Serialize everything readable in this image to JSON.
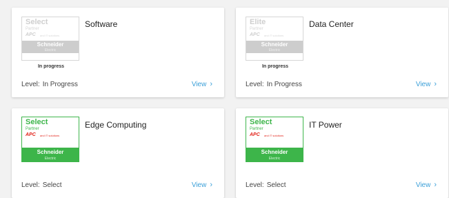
{
  "cards": [
    {
      "title": "Software",
      "badge": {
        "tier": "Select",
        "sub": "Partner",
        "brand": "APC",
        "brand_note": "and IT solutions",
        "bar": "Schneider",
        "bar_sub": "Electric",
        "status": "In progress"
      },
      "level_label": "Level:",
      "level_value": "In Progress",
      "view_label": "View",
      "view_icon": "chevron-right",
      "active": false
    },
    {
      "title": "Data Center",
      "badge": {
        "tier": "Elite",
        "sub": "Partner",
        "brand": "APC",
        "brand_note": "and IT solutions",
        "bar": "Schneider",
        "bar_sub": "Electric",
        "status": "In progress"
      },
      "level_label": "Level:",
      "level_value": "In Progress",
      "view_label": "View",
      "view_icon": "chevron-right",
      "active": false
    },
    {
      "title": "Edge Computing",
      "badge": {
        "tier": "Select",
        "sub": "Partner",
        "brand": "APC",
        "brand_note": "and IT solutions",
        "bar": "Schneider",
        "bar_sub": "Electric"
      },
      "level_label": "Level:",
      "level_value": "Select",
      "view_label": "View",
      "view_icon": "chevron-right",
      "active": true
    },
    {
      "title": "IT Power",
      "badge": {
        "tier": "Select",
        "sub": "Partner",
        "brand": "APC",
        "brand_note": "and IT solutions",
        "bar": "Schneider",
        "bar_sub": "Electric"
      },
      "level_label": "Level:",
      "level_value": "Select",
      "view_label": "View",
      "view_icon": "chevron-right",
      "active": true
    }
  ],
  "colors": {
    "accent": "#3a9fd8",
    "active_green": "#3db54a",
    "apc_red": "#e2231a",
    "inactive_gray": "#cdcdcd"
  }
}
